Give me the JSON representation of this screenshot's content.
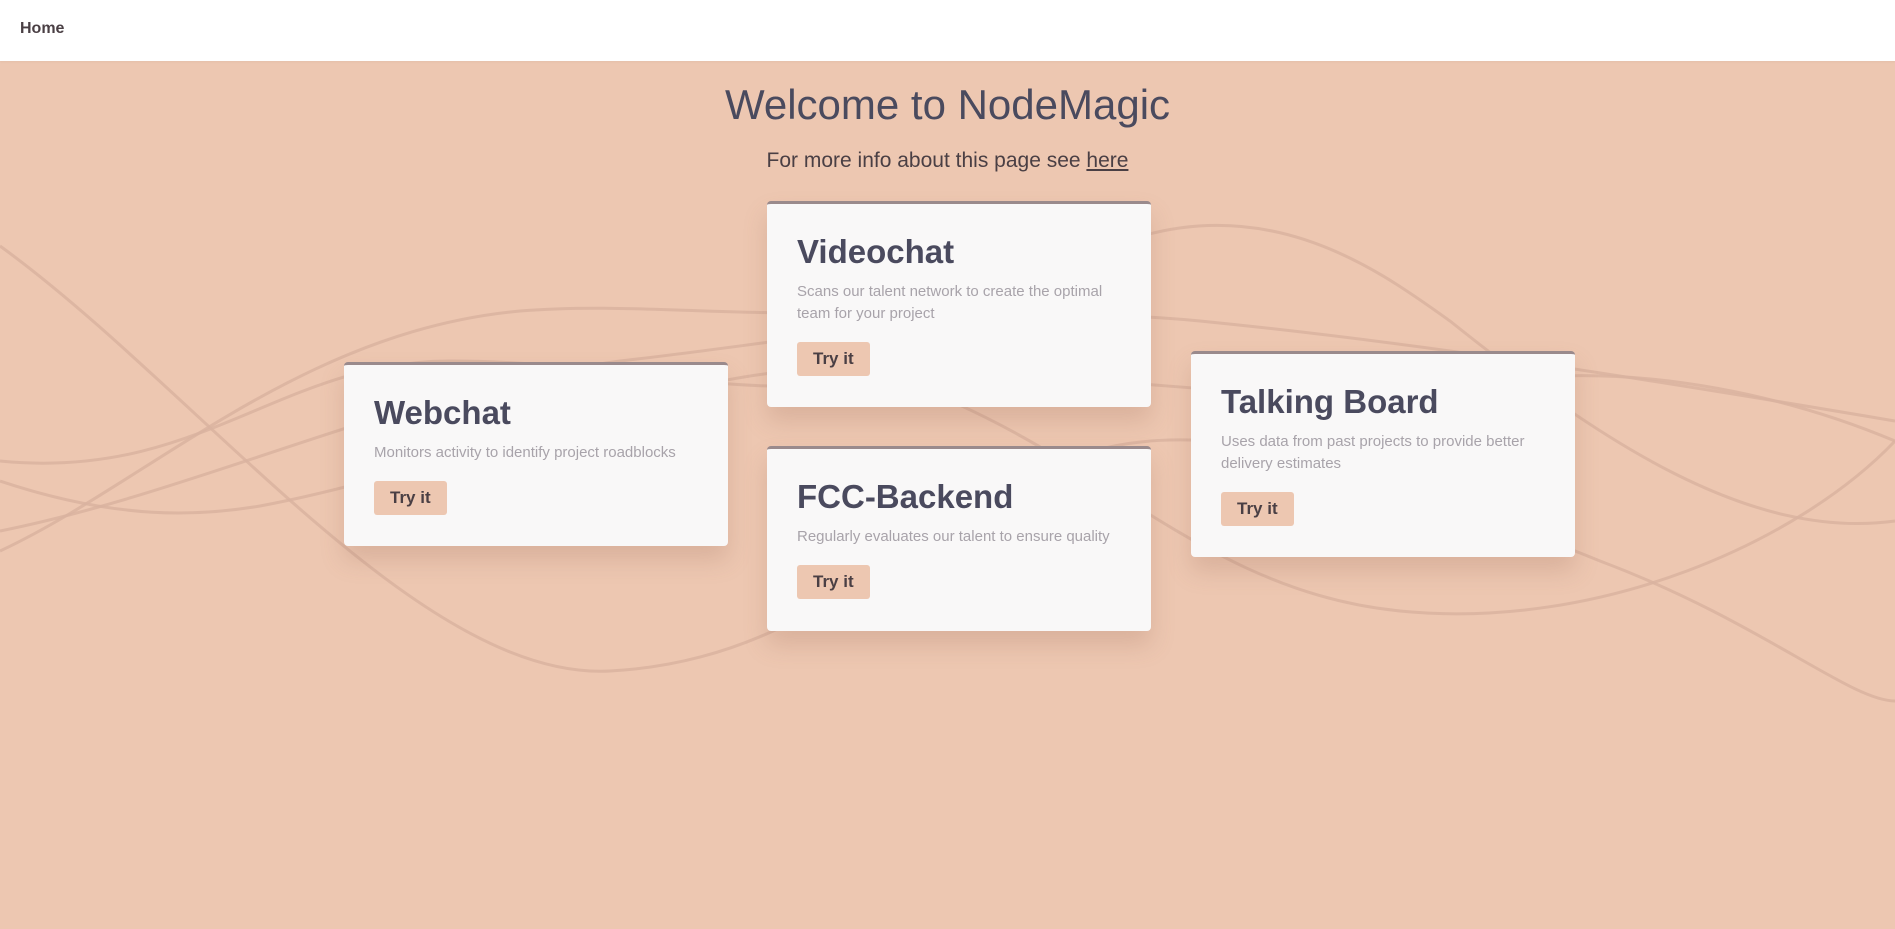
{
  "nav": {
    "home_label": "Home"
  },
  "header": {
    "title": "Welcome to NodeMagic",
    "subtitle_prefix": "For more info about this page see",
    "subtitle_link": "here"
  },
  "cards": [
    {
      "title": "Videochat",
      "description": "Scans our talent network to create the optimal team for your project",
      "button_label": "Try it"
    },
    {
      "title": "Webchat",
      "description": "Monitors activity to identify project roadblocks",
      "button_label": "Try it"
    },
    {
      "title": "FCC-Backend",
      "description": "Regularly evaluates our talent to ensure quality",
      "button_label": "Try it"
    },
    {
      "title": "Talking Board",
      "description": "Uses data from past projects to provide better delivery estimates",
      "button_label": "Try it"
    }
  ],
  "colors": {
    "background": "#edc7b1",
    "card": "#f9f8f8",
    "title_text": "#4a4a5e",
    "wave_lines": "#d9b3a0"
  }
}
